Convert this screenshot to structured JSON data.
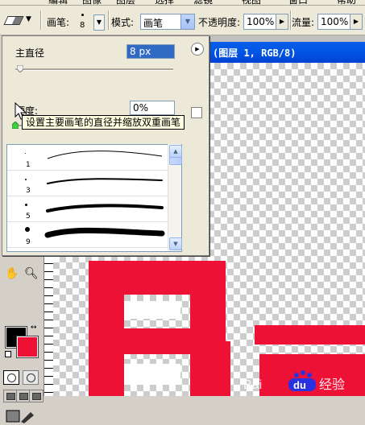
{
  "menu": {
    "items": [
      "编辑",
      "图像",
      "图层",
      "选择",
      "滤镜",
      "视图",
      "窗口",
      "帮助"
    ]
  },
  "options_bar": {
    "brush_label": "画笔:",
    "brush_size_number": "8",
    "mode_label": "模式:",
    "mode_value": "画笔",
    "opacity_label": "不透明度:",
    "opacity_value": "100%",
    "flow_label": "流量:",
    "flow_value": "100%"
  },
  "document": {
    "title": "(图层 1, RGB/8)"
  },
  "brush_panel": {
    "master_diameter_label": "主直径",
    "master_diameter_value": "8 px",
    "tooltip": "设置主要画笔的直径并缩放双重画笔",
    "hardness_label": "硬度:",
    "hardness_value": "0%",
    "brushes": [
      {
        "size": "1"
      },
      {
        "size": "3"
      },
      {
        "size": "5"
      },
      {
        "size": "9"
      }
    ]
  },
  "colors": {
    "foreground": "#000000",
    "background": "#ee1136",
    "title_bar": "#0058e6",
    "canvas_red": "#ee1136"
  },
  "watermark": {
    "text": "Bai du 经验"
  }
}
